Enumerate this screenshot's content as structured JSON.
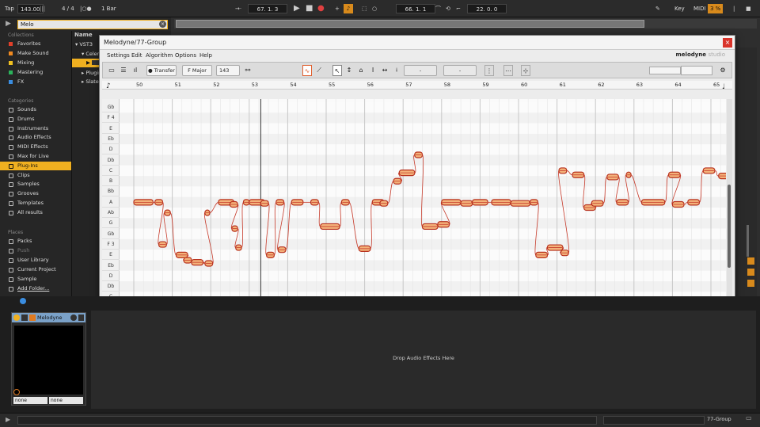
{
  "topbar": {
    "tap": "Tap",
    "tempo": "143.00",
    "meter": "4 / 4",
    "quantize": "1 Bar",
    "position": "67.  1.  3",
    "loop_start": "66.  1.  1",
    "loop_length": "22.  0.  0",
    "key": "Key",
    "midi": "MIDI",
    "midi_pct": "3 %"
  },
  "browser": {
    "search": "Melo",
    "collections_title": "Collections",
    "collections": [
      {
        "label": "Favorites",
        "color": "#e0402a"
      },
      {
        "label": "Make Sound",
        "color": "#f08a20"
      },
      {
        "label": "Mixing",
        "color": "#f0c020"
      },
      {
        "label": "Mastering",
        "color": "#2bb35b"
      },
      {
        "label": "FX",
        "color": "#3a8de0"
      }
    ],
    "categories_title": "Categories",
    "categories": [
      "Sounds",
      "Drums",
      "Instruments",
      "Audio Effects",
      "MIDI Effects",
      "Max for Live",
      "Plug-Ins",
      "Clips",
      "Samples",
      "Grooves",
      "Templates",
      "All results"
    ],
    "places_title": "Places",
    "places": [
      "Packs",
      "Push",
      "User Library",
      "Current Project",
      "Sample",
      "Add Folder..."
    ],
    "name_header": "Name",
    "tree": [
      "VST3",
      "Celem",
      "",
      "Plugin",
      "Slate"
    ]
  },
  "melodyne": {
    "title": "Melodyne/77-Group",
    "close": "×",
    "menu": [
      "Settings",
      "Edit",
      "Algorithm",
      "Options",
      "Help"
    ],
    "logo_main": "melodyne",
    "logo_sub": "studio",
    "transfer": "Transfer",
    "scale": "F Major",
    "tempo": "143",
    "field1": "-",
    "field2": "-",
    "bars": [
      "50",
      "51",
      "52",
      "53",
      "54",
      "55",
      "56",
      "57",
      "58",
      "59",
      "60",
      "61",
      "62",
      "63",
      "64",
      "65"
    ],
    "pitches": [
      "Gb",
      "F 4",
      "E",
      "Eb",
      "D",
      "Db",
      "C",
      "B",
      "Bb",
      "A",
      "Ab",
      "G",
      "Gb",
      "F 3",
      "E",
      "Eb",
      "D",
      "Db",
      "C",
      "B"
    ]
  },
  "device": {
    "title": "Melodyne",
    "sel1": "none",
    "sel2": "none"
  },
  "drop_text": "Drop Audio Effects Here",
  "status": {
    "track": "77-Group"
  },
  "notes": [
    {
      "bar": 50.0,
      "len": 0.5,
      "p": 9
    },
    {
      "bar": 50.55,
      "len": 0.2,
      "p": 9
    },
    {
      "bar": 50.65,
      "len": 0.2,
      "p": 13
    },
    {
      "bar": 50.8,
      "len": 0.15,
      "p": 10
    },
    {
      "bar": 51.1,
      "len": 0.3,
      "p": 14
    },
    {
      "bar": 51.3,
      "len": 0.2,
      "p": 14.5
    },
    {
      "bar": 51.5,
      "len": 0.3,
      "p": 14.7
    },
    {
      "bar": 51.85,
      "len": 0.2,
      "p": 14.8
    },
    {
      "bar": 51.85,
      "len": 0.1,
      "p": 10
    },
    {
      "bar": 52.2,
      "len": 0.4,
      "p": 9
    },
    {
      "bar": 52.5,
      "len": 0.2,
      "p": 9.2
    },
    {
      "bar": 52.55,
      "len": 0.15,
      "p": 11.5
    },
    {
      "bar": 52.65,
      "len": 0.15,
      "p": 13.3
    },
    {
      "bar": 52.85,
      "len": 0.15,
      "p": 9
    },
    {
      "bar": 53.0,
      "len": 0.4,
      "p": 9
    },
    {
      "bar": 53.3,
      "len": 0.2,
      "p": 9.1
    },
    {
      "bar": 53.45,
      "len": 0.2,
      "p": 14
    },
    {
      "bar": 53.7,
      "len": 0.2,
      "p": 9
    },
    {
      "bar": 53.75,
      "len": 0.2,
      "p": 13.5
    },
    {
      "bar": 54.1,
      "len": 0.3,
      "p": 9
    },
    {
      "bar": 54.6,
      "len": 0.2,
      "p": 9
    },
    {
      "bar": 54.85,
      "len": 0.5,
      "p": 11.3
    },
    {
      "bar": 55.4,
      "len": 0.2,
      "p": 9
    },
    {
      "bar": 55.85,
      "len": 0.3,
      "p": 13.4
    },
    {
      "bar": 56.2,
      "len": 0.3,
      "p": 9
    },
    {
      "bar": 56.4,
      "len": 0.2,
      "p": 9.1
    },
    {
      "bar": 56.75,
      "len": 0.2,
      "p": 7
    },
    {
      "bar": 56.9,
      "len": 0.4,
      "p": 6.2
    },
    {
      "bar": 57.3,
      "len": 0.2,
      "p": 4.5
    },
    {
      "bar": 57.5,
      "len": 0.4,
      "p": 11.3
    },
    {
      "bar": 57.9,
      "len": 0.3,
      "p": 11.1
    },
    {
      "bar": 58.0,
      "len": 0.5,
      "p": 9
    },
    {
      "bar": 58.5,
      "len": 0.3,
      "p": 9.1
    },
    {
      "bar": 58.8,
      "len": 0.4,
      "p": 9
    },
    {
      "bar": 59.3,
      "len": 0.5,
      "p": 9
    },
    {
      "bar": 59.8,
      "len": 0.5,
      "p": 9.1
    },
    {
      "bar": 60.3,
      "len": 0.2,
      "p": 9
    },
    {
      "bar": 60.45,
      "len": 0.3,
      "p": 14
    },
    {
      "bar": 60.75,
      "len": 0.4,
      "p": 13.3
    },
    {
      "bar": 61.1,
      "len": 0.2,
      "p": 13.8
    },
    {
      "bar": 61.05,
      "len": 0.2,
      "p": 6
    },
    {
      "bar": 61.4,
      "len": 0.3,
      "p": 6.4
    },
    {
      "bar": 61.7,
      "len": 0.3,
      "p": 9.5
    },
    {
      "bar": 61.9,
      "len": 0.3,
      "p": 9.1
    },
    {
      "bar": 62.3,
      "len": 0.3,
      "p": 6.6
    },
    {
      "bar": 62.55,
      "len": 0.3,
      "p": 9
    },
    {
      "bar": 62.8,
      "len": 0.1,
      "p": 6.4
    },
    {
      "bar": 63.2,
      "len": 0.6,
      "p": 9
    },
    {
      "bar": 63.9,
      "len": 0.3,
      "p": 6.4
    },
    {
      "bar": 64.0,
      "len": 0.3,
      "p": 9.2
    },
    {
      "bar": 64.4,
      "len": 0.3,
      "p": 9
    },
    {
      "bar": 64.8,
      "len": 0.3,
      "p": 6
    },
    {
      "bar": 65.2,
      "len": 0.3,
      "p": 6.5
    },
    {
      "bar": 65.45,
      "len": 0.15,
      "p": 12
    }
  ]
}
